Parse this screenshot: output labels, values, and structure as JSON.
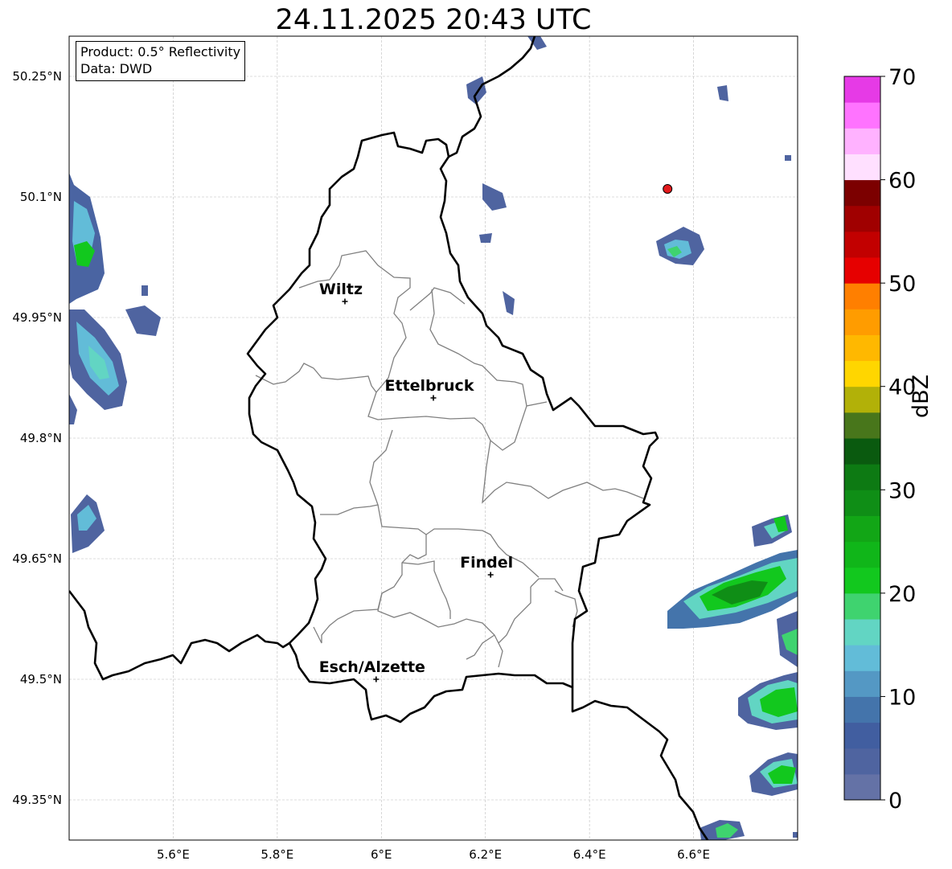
{
  "title": "24.11.2025 20:43 UTC",
  "info": {
    "product": "Product: 0.5° Reflectivity",
    "data": "Data: DWD"
  },
  "map": {
    "extent": {
      "lon": [
        5.4,
        6.8
      ],
      "lat": [
        49.3,
        50.3
      ]
    },
    "lon_ticks": [
      "5.6°E",
      "5.8°E",
      "6°E",
      "6.2°E",
      "6.4°E",
      "6.6°E"
    ],
    "lat_ticks": [
      "50.25°N",
      "50.1°N",
      "49.95°N",
      "49.8°N",
      "49.65°N",
      "49.5°N",
      "49.35°N"
    ],
    "grid": true,
    "cities": [
      {
        "name": "Wiltz",
        "lon": 5.93,
        "lat": 49.97
      },
      {
        "name": "Ettelbruck",
        "lon": 6.1,
        "lat": 49.85
      },
      {
        "name": "Findel",
        "lon": 6.21,
        "lat": 49.63
      },
      {
        "name": "Esch/Alzette",
        "lon": 5.99,
        "lat": 49.5
      }
    ],
    "radar_site": {
      "lon": 6.55,
      "lat": 50.11,
      "color": "#e31a1c"
    }
  },
  "colorbar": {
    "label": "dBZ",
    "ticks": [
      "0",
      "10",
      "20",
      "30",
      "40",
      "50",
      "60",
      "70"
    ],
    "colors": [
      "#6472a6",
      "#4f64a0",
      "#415ea0",
      "#4474ab",
      "#5498c4",
      "#62bcd8",
      "#62d5c3",
      "#3fd36f",
      "#12c81e",
      "#10b619",
      "#12a616",
      "#0f8e16",
      "#0d7a13",
      "#0a5a0f",
      "#48761b",
      "#b2b108",
      "#ffd600",
      "#ffb800",
      "#ff9c00",
      "#ff7f00",
      "#e60000",
      "#c20000",
      "#a00000",
      "#7c0000",
      "#ffe0ff",
      "#ffb2ff",
      "#ff73ff",
      "#e63ae6"
    ]
  }
}
